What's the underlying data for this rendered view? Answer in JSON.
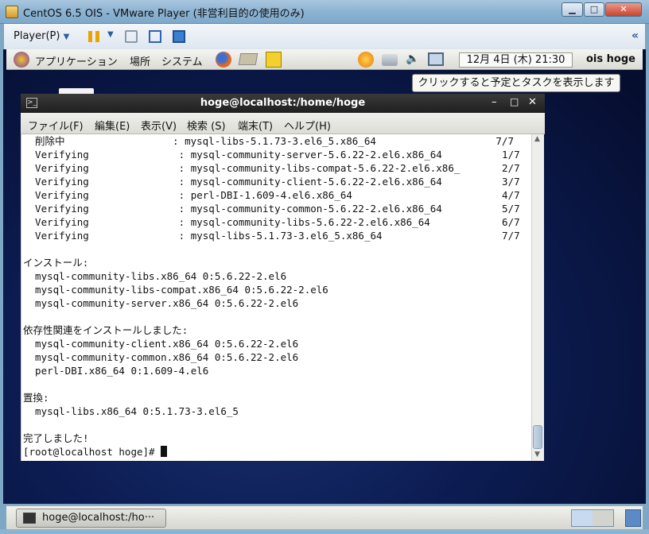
{
  "vm_window": {
    "title": "CentOS 6.5 OIS - VMware Player (非営利目的の使用のみ)",
    "minimize_icon": "minimize-icon",
    "maximize_icon": "maximize-icon",
    "close_icon": "close-icon"
  },
  "vm_toolbar": {
    "player_menu": "Player(P)",
    "icons": [
      "pause-icon",
      "dropdown-icon",
      "send-ctrl-alt-del-icon",
      "fullscreen-icon",
      "unity-icon"
    ],
    "collapse_icon": "double-chevron-left-icon"
  },
  "gnome_panel": {
    "menus": [
      "アプリケーション",
      "場所",
      "システム"
    ],
    "launchers": [
      "firefox-icon",
      "mail-icon",
      "notes-icon"
    ],
    "tray": [
      "update-icon",
      "network-icon",
      "volume-icon",
      "network-manager-icon"
    ],
    "clock": "12月 4日 (木) 21:30",
    "user": "ois hoge"
  },
  "tooltip": "クリックすると予定とタスクを表示します",
  "terminal": {
    "title": "hoge@localhost:/home/hoge",
    "menus": [
      "ファイル(F)",
      "編集(E)",
      "表示(V)",
      "検索 (S)",
      "端末(T)",
      "ヘルプ(H)"
    ],
    "lines": [
      "  削除中                  : mysql-libs-5.1.73-3.el6_5.x86_64                    7/7",
      "  Verifying               : mysql-community-server-5.6.22-2.el6.x86_64          1/7",
      "  Verifying               : mysql-community-libs-compat-5.6.22-2.el6.x86_       2/7",
      "  Verifying               : mysql-community-client-5.6.22-2.el6.x86_64          3/7",
      "  Verifying               : perl-DBI-1.609-4.el6.x86_64                         4/7",
      "  Verifying               : mysql-community-common-5.6.22-2.el6.x86_64          5/7",
      "  Verifying               : mysql-community-libs-5.6.22-2.el6.x86_64            6/7",
      "  Verifying               : mysql-libs-5.1.73-3.el6_5.x86_64                    7/7",
      "",
      "インストール:",
      "  mysql-community-libs.x86_64 0:5.6.22-2.el6",
      "  mysql-community-libs-compat.x86_64 0:5.6.22-2.el6",
      "  mysql-community-server.x86_64 0:5.6.22-2.el6",
      "",
      "依存性関連をインストールしました:",
      "  mysql-community-client.x86_64 0:5.6.22-2.el6",
      "  mysql-community-common.x86_64 0:5.6.22-2.el6",
      "  perl-DBI.x86_64 0:1.609-4.el6",
      "",
      "置換:",
      "  mysql-libs.x86_64 0:5.1.73-3.el6_5",
      "",
      "完了しました!",
      "[root@localhost hoge]# "
    ]
  },
  "taskbar": {
    "task": "hoge@localhost:/ho···"
  }
}
